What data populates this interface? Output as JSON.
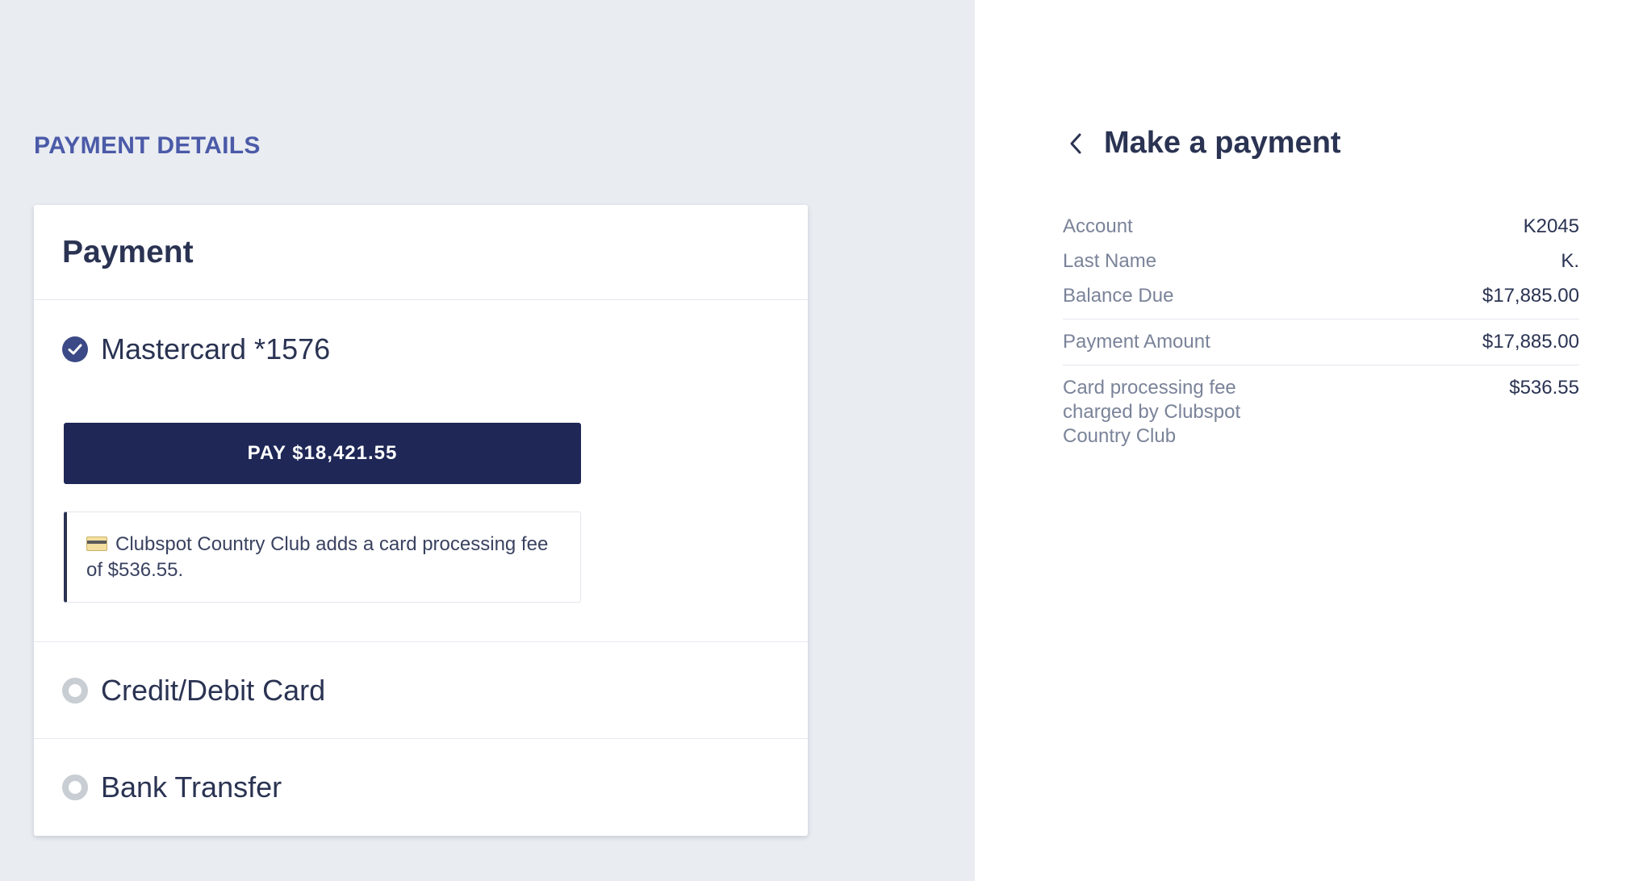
{
  "left": {
    "section_heading": "PAYMENT DETAILS",
    "card_title": "Payment",
    "selected_method": {
      "label": "Mastercard *1576",
      "icon": "check-circle-icon",
      "pay_button_label": "PAY $18,421.55",
      "notice_icon": "credit-card-icon",
      "notice_text": "Clubspot Country Club adds a card processing fee of $536.55."
    },
    "methods": [
      {
        "label": "Credit/Debit Card",
        "icon": "radio-unchecked-icon"
      },
      {
        "label": "Bank Transfer",
        "icon": "radio-unchecked-icon"
      }
    ]
  },
  "right": {
    "back_icon": "chevron-left-icon",
    "title": "Make a payment",
    "summary": {
      "account": {
        "label": "Account",
        "value": "K2045"
      },
      "last_name": {
        "label": "Last Name",
        "value": "K."
      },
      "balance_due": {
        "label": "Balance Due",
        "value": "$17,885.00"
      },
      "payment_amount": {
        "label": "Payment Amount",
        "value": "$17,885.00"
      },
      "processing_fee": {
        "label": "Card processing fee charged by Clubspot Country Club",
        "value": "$536.55"
      }
    }
  },
  "colors": {
    "left_background": "#e9ecf1",
    "accent_heading": "#4b5aa8",
    "pay_button": "#1e2756",
    "text_primary": "#2a3352",
    "text_muted": "#7a8399",
    "radio_ring": "#c8ced3"
  }
}
